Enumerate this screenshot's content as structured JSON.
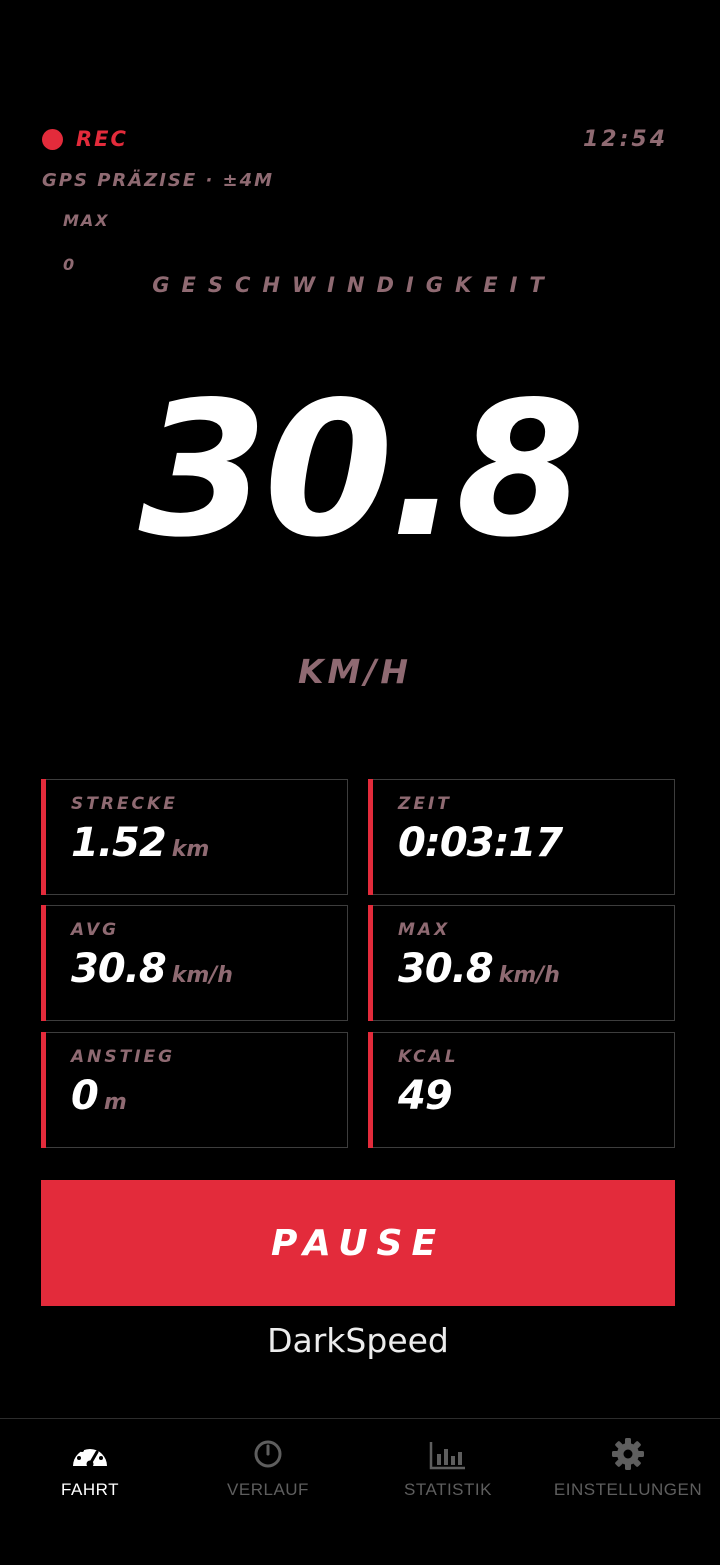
{
  "status": {
    "rec_label": "REC",
    "clock": "12:54",
    "gps_text": "GPS PRÄZISE · ±4M",
    "max_label": "MAX",
    "max_value": "0"
  },
  "speed": {
    "label": "GESCHWINDIGKEIT",
    "value": "30.8",
    "unit": "KM/H"
  },
  "stats": {
    "distance": {
      "label": "STRECKE",
      "value": "1.52",
      "unit": "km"
    },
    "time": {
      "label": "ZEIT",
      "value": "0:03:17",
      "unit": ""
    },
    "avg": {
      "label": "AVG",
      "value": "30.8",
      "unit": "km/h"
    },
    "max": {
      "label": "MAX",
      "value": "30.8",
      "unit": "km/h"
    },
    "ascent": {
      "label": "ANSTIEG",
      "value": "0",
      "unit": "m"
    },
    "kcal": {
      "label": "KCAL",
      "value": "49",
      "unit": ""
    }
  },
  "pause_label": "PAUSE",
  "app_name": "DarkSpeed",
  "nav": {
    "items": [
      {
        "label": "FAHRT",
        "icon": "speedometer-icon",
        "active": true
      },
      {
        "label": "VERLAUF",
        "icon": "clock-icon",
        "active": false
      },
      {
        "label": "STATISTIK",
        "icon": "bar-chart-icon",
        "active": false
      },
      {
        "label": "EINSTELLUNGEN",
        "icon": "gear-icon",
        "active": false
      }
    ]
  },
  "colors": {
    "accent": "#e32b3b",
    "muted_text": "#8f6a72",
    "background": "#000000",
    "card_border": "#3d3d3d",
    "nav_active": "#ffffff",
    "nav_inactive": "#5e5e5e"
  }
}
